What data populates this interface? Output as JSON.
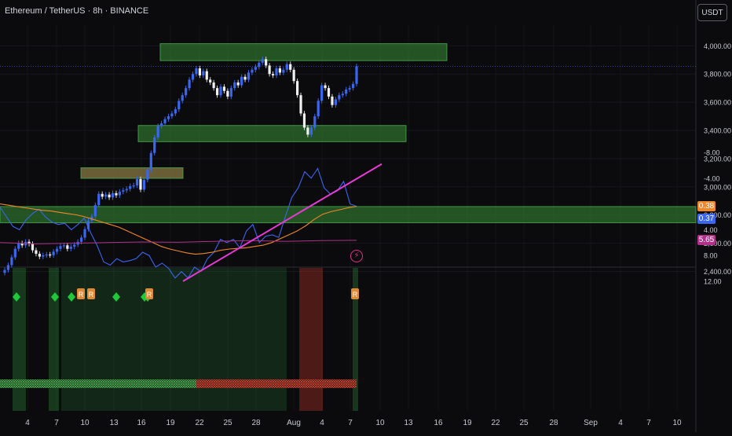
{
  "header": {
    "title": "Ethereum / TetherUS · 8h · BINANCE",
    "unit_label": "USDT"
  },
  "chart_data": [
    {
      "type": "candlestick",
      "title": "Ethereum / TetherUS · 8h · BINANCE",
      "unit": "USDT",
      "ylim": [
        2350,
        4080
      ],
      "y_ticks": [
        "2,400.00",
        "2,600.00",
        "2,800.00",
        "3,000.00",
        "3,200.00",
        "3,400.00",
        "3,600.00",
        "3,800.00",
        "4,000.00"
      ],
      "y_tick_values": [
        2400,
        2600,
        2800,
        3000,
        3200,
        3400,
        3600,
        3800,
        4000
      ],
      "x_labels": [
        "4",
        "7",
        "10",
        "13",
        "16",
        "19",
        "22",
        "25",
        "28",
        "Aug",
        "4",
        "7",
        "10",
        "13",
        "16",
        "19",
        "22",
        "25",
        "28",
        "Sep",
        "4",
        "7",
        "10"
      ],
      "closes": [
        2410,
        2445,
        2500,
        2560,
        2600,
        2585,
        2610,
        2595,
        2550,
        2525,
        2505,
        2515,
        2520,
        2515,
        2540,
        2560,
        2580,
        2585,
        2560,
        2575,
        2590,
        2610,
        2640,
        2700,
        2760,
        2790,
        2870,
        2950,
        2930,
        2945,
        2925,
        2955,
        2940,
        2965,
        2975,
        2985,
        3005,
        3010,
        3055,
        2980,
        3050,
        3120,
        3240,
        3350,
        3430,
        3450,
        3480,
        3500,
        3520,
        3550,
        3610,
        3650,
        3700,
        3760,
        3800,
        3840,
        3790,
        3820,
        3760,
        3740,
        3700,
        3650,
        3710,
        3680,
        3640,
        3700,
        3740,
        3720,
        3780,
        3760,
        3810,
        3830,
        3850,
        3880,
        3905,
        3860,
        3800,
        3790,
        3840,
        3810,
        3830,
        3870,
        3830,
        3750,
        3650,
        3520,
        3420,
        3370,
        3420,
        3500,
        3610,
        3720,
        3700,
        3640,
        3580,
        3620,
        3650,
        3660,
        3690,
        3700,
        3730,
        3855
      ],
      "zones": [
        {
          "low": 3895,
          "high": 4015,
          "color": "#2e6d2c"
        },
        {
          "low": 3320,
          "high": 3435,
          "color": "#2e6d2c"
        },
        {
          "low": 3060,
          "high": 3135,
          "color": "#8a7a44"
        },
        {
          "low": 2745,
          "high": 2860,
          "color": "#2e6d2c"
        }
      ],
      "colors": {
        "candle": "#3a66f0",
        "candle_up": "#f0f0f0"
      }
    },
    {
      "type": "line",
      "ylim": [
        -8,
        14
      ],
      "y_ticks": [
        "12.00",
        "8.00",
        "4.00",
        "-4.00",
        "-8.00"
      ],
      "y_tick_values": [
        12,
        8,
        4,
        -4,
        -8
      ],
      "series": [
        {
          "key": "fast",
          "color": "#3a66f0",
          "values": [
            0.5,
            2.0,
            3.5,
            4.0,
            2.5,
            1.5,
            0.8,
            2.0,
            2.8,
            3.2,
            3.0,
            4.0,
            3.2,
            2.2,
            4.5,
            6.5,
            9.0,
            9.5,
            8.5,
            9.0,
            8.8,
            8.5,
            7.5,
            8.0,
            9.8,
            9.2,
            10.0,
            11.5,
            10.5,
            11.5,
            9.8,
            10.5,
            8.5,
            7.5,
            5.5,
            6.0,
            5.5,
            6.8,
            4.2,
            3.2,
            6.0,
            5.0,
            4.8,
            5.2,
            2.0,
            -1.0,
            -2.5,
            -5.0,
            -4.0,
            -5.5,
            -2.5,
            -1.5,
            -2.0,
            -3.5,
            0.0,
            0.37
          ]
        },
        {
          "key": "slow",
          "color": "#f0872a",
          "values": [
            0.0,
            0.2,
            0.4,
            0.6,
            0.8,
            1.0,
            1.1,
            1.3,
            1.5,
            1.7,
            2.0,
            2.4,
            2.8,
            3.2,
            3.6,
            4.2,
            4.8,
            5.4,
            6.0,
            6.6,
            7.0,
            7.3,
            7.6,
            7.8,
            7.7,
            7.5,
            7.2,
            7.0,
            6.9,
            6.8,
            6.6,
            6.4,
            6.0,
            5.4,
            4.8,
            4.2,
            3.4,
            2.4,
            1.6,
            1.2,
            0.9,
            0.6,
            0.38
          ]
        },
        {
          "key": "flat",
          "color": "#b0308a",
          "values": [
            6.0,
            6.2,
            6.1,
            6.0,
            5.9,
            5.95,
            5.8,
            5.7,
            5.8,
            5.7,
            5.65
          ]
        }
      ],
      "trendline": {
        "from": [
          0.5,
          12.0
        ],
        "to": [
          0.99,
          -6.2
        ],
        "color": "#e83ad6"
      },
      "value_tags": [
        {
          "value": 5.65,
          "label": "5.65",
          "color": "#b0308a"
        },
        {
          "value": 0.38,
          "label": "0.38",
          "color": "#f0872a"
        },
        {
          "value": 0.37,
          "label": "0.37",
          "color": "#3a66f0"
        }
      ],
      "diamond_markers": 6,
      "r_labels": [
        "R",
        "R",
        "R",
        "R"
      ],
      "band_colors": {
        "bullish": "#2e8c3a",
        "bearish": "#c83a2a"
      }
    }
  ]
}
